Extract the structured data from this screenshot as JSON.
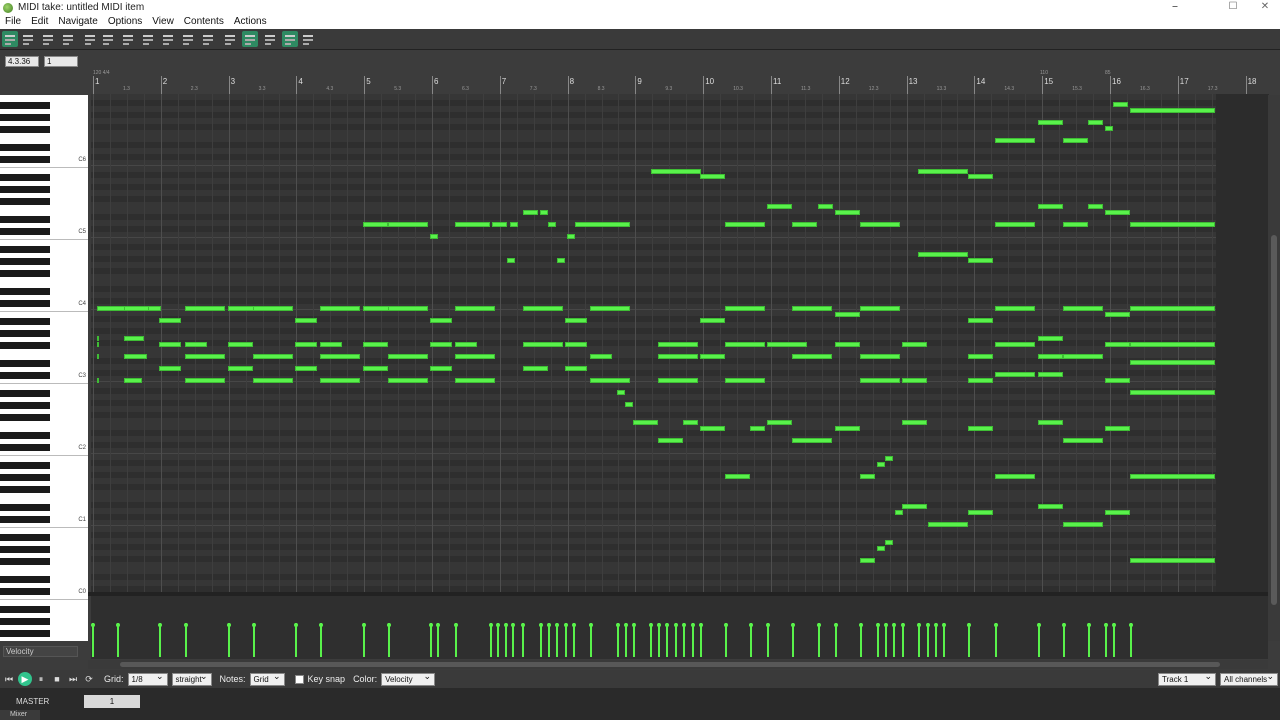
{
  "window": {
    "title": "MIDI take: untitled MIDI item",
    "min": "⎯",
    "max": "☐",
    "close": "✕"
  },
  "menu": [
    "File",
    "Edit",
    "Navigate",
    "Options",
    "View",
    "Contents",
    "Actions"
  ],
  "toolbar": {
    "icons": [
      "piano-roll-icon",
      "named-notes-icon",
      "drum-grid-icon",
      "event-list-icon",
      "snap-to-key-icon",
      "quantize-icon",
      "humanize-icon",
      "velocity-icon",
      "filter-icon",
      "window-icon",
      "loop-icon",
      "grid-icon",
      "snap-icon",
      "dots-grid-icon",
      "lasso-icon",
      "metronome-icon",
      "step-input-icon"
    ]
  },
  "position": {
    "time": "4.3.36",
    "value": "1"
  },
  "ruler": {
    "bars": [
      "1",
      "2",
      "3",
      "4",
      "5",
      "6",
      "7",
      "8",
      "9",
      "10",
      "11",
      "12",
      "13",
      "14",
      "15",
      "16",
      "17",
      "18"
    ],
    "subs": [
      "1.3",
      "2.3",
      "3.3",
      "4.3",
      "5.3",
      "6.3",
      "7.3",
      "8.3",
      "9.3",
      "10.3",
      "11.3",
      "12.3",
      "13.3",
      "14.3",
      "15.3",
      "16.3",
      "17.3"
    ],
    "markers": [
      "120 4/4",
      "110",
      "85"
    ]
  },
  "keyboard": {
    "labels": [
      "C6",
      "C5",
      "C4",
      "C3",
      "C2",
      "C1",
      "C0"
    ]
  },
  "notes": [
    [
      97,
      306,
      64
    ],
    [
      97,
      336,
      1
    ],
    [
      97,
      354,
      1
    ],
    [
      97,
      378,
      1
    ],
    [
      97,
      342,
      1
    ],
    [
      124,
      306,
      25
    ],
    [
      124,
      336,
      20
    ],
    [
      124,
      354,
      23
    ],
    [
      124,
      378,
      18
    ],
    [
      159,
      318,
      22
    ],
    [
      159,
      342,
      22
    ],
    [
      159,
      366,
      22
    ],
    [
      185,
      306,
      40
    ],
    [
      185,
      354,
      40
    ],
    [
      185,
      378,
      40
    ],
    [
      185,
      342,
      22
    ],
    [
      228,
      342,
      25
    ],
    [
      228,
      306,
      40
    ],
    [
      228,
      366,
      25
    ],
    [
      253,
      354,
      40
    ],
    [
      253,
      306,
      40
    ],
    [
      253,
      378,
      40
    ],
    [
      295,
      318,
      22
    ],
    [
      295,
      342,
      22
    ],
    [
      295,
      366,
      22
    ],
    [
      320,
      306,
      40
    ],
    [
      320,
      354,
      40
    ],
    [
      320,
      378,
      40
    ],
    [
      320,
      342,
      22
    ],
    [
      363,
      222,
      25
    ],
    [
      363,
      342,
      25
    ],
    [
      363,
      306,
      40
    ],
    [
      363,
      366,
      25
    ],
    [
      388,
      222,
      40
    ],
    [
      388,
      354,
      40
    ],
    [
      388,
      306,
      40
    ],
    [
      388,
      378,
      40
    ],
    [
      430,
      318,
      22
    ],
    [
      430,
      342,
      22
    ],
    [
      430,
      366,
      22
    ],
    [
      430,
      234,
      8
    ],
    [
      455,
      222,
      35
    ],
    [
      455,
      306,
      40
    ],
    [
      455,
      354,
      40
    ],
    [
      455,
      378,
      40
    ],
    [
      455,
      342,
      22
    ],
    [
      492,
      222,
      15
    ],
    [
      510,
      222,
      8
    ],
    [
      507,
      258,
      8
    ],
    [
      523,
      210,
      15
    ],
    [
      523,
      306,
      40
    ],
    [
      523,
      342,
      40
    ],
    [
      523,
      366,
      25
    ],
    [
      540,
      210,
      8
    ],
    [
      548,
      222,
      8
    ],
    [
      557,
      258,
      8
    ],
    [
      565,
      318,
      22
    ],
    [
      565,
      342,
      22
    ],
    [
      565,
      366,
      22
    ],
    [
      567,
      234,
      8
    ],
    [
      575,
      222,
      55
    ],
    [
      590,
      306,
      40
    ],
    [
      590,
      378,
      40
    ],
    [
      590,
      354,
      22
    ],
    [
      617,
      390,
      8
    ],
    [
      625,
      402,
      8
    ],
    [
      633,
      420,
      25
    ],
    [
      651,
      169,
      50
    ],
    [
      658,
      342,
      40
    ],
    [
      658,
      354,
      40
    ],
    [
      658,
      378,
      40
    ],
    [
      658,
      438,
      25
    ],
    [
      683,
      420,
      15
    ],
    [
      700,
      174,
      25
    ],
    [
      700,
      318,
      25
    ],
    [
      700,
      354,
      25
    ],
    [
      700,
      426,
      25
    ],
    [
      725,
      222,
      40
    ],
    [
      725,
      306,
      40
    ],
    [
      725,
      342,
      40
    ],
    [
      725,
      378,
      40
    ],
    [
      725,
      474,
      25
    ],
    [
      750,
      426,
      15
    ],
    [
      767,
      204,
      25
    ],
    [
      767,
      342,
      40
    ],
    [
      767,
      420,
      25
    ],
    [
      792,
      222,
      25
    ],
    [
      792,
      306,
      40
    ],
    [
      792,
      354,
      40
    ],
    [
      792,
      438,
      40
    ],
    [
      818,
      204,
      15
    ],
    [
      835,
      210,
      25
    ],
    [
      835,
      312,
      25
    ],
    [
      835,
      342,
      25
    ],
    [
      835,
      426,
      25
    ],
    [
      860,
      222,
      40
    ],
    [
      860,
      306,
      40
    ],
    [
      860,
      354,
      40
    ],
    [
      860,
      378,
      40
    ],
    [
      860,
      474,
      15
    ],
    [
      860,
      558,
      15
    ],
    [
      877,
      462,
      8
    ],
    [
      885,
      456,
      8
    ],
    [
      877,
      546,
      8
    ],
    [
      885,
      540,
      8
    ],
    [
      895,
      510,
      8
    ],
    [
      902,
      342,
      25
    ],
    [
      902,
      378,
      25
    ],
    [
      902,
      420,
      25
    ],
    [
      902,
      504,
      25
    ],
    [
      918,
      169,
      50
    ],
    [
      918,
      252,
      50
    ],
    [
      928,
      522,
      40
    ],
    [
      968,
      174,
      25
    ],
    [
      968,
      258,
      25
    ],
    [
      968,
      318,
      25
    ],
    [
      968,
      354,
      25
    ],
    [
      968,
      378,
      25
    ],
    [
      968,
      426,
      25
    ],
    [
      968,
      510,
      25
    ],
    [
      995,
      138,
      40
    ],
    [
      995,
      222,
      40
    ],
    [
      995,
      306,
      40
    ],
    [
      995,
      342,
      40
    ],
    [
      995,
      372,
      40
    ],
    [
      995,
      474,
      40
    ],
    [
      1038,
      120,
      25
    ],
    [
      1038,
      204,
      25
    ],
    [
      1038,
      336,
      25
    ],
    [
      1038,
      354,
      25
    ],
    [
      1038,
      372,
      25
    ],
    [
      1038,
      420,
      25
    ],
    [
      1038,
      504,
      25
    ],
    [
      1063,
      138,
      25
    ],
    [
      1063,
      222,
      25
    ],
    [
      1063,
      306,
      40
    ],
    [
      1063,
      354,
      40
    ],
    [
      1063,
      438,
      40
    ],
    [
      1063,
      522,
      40
    ],
    [
      1088,
      120,
      15
    ],
    [
      1088,
      204,
      15
    ],
    [
      1105,
      126,
      8
    ],
    [
      1105,
      210,
      25
    ],
    [
      1105,
      312,
      25
    ],
    [
      1105,
      342,
      25
    ],
    [
      1105,
      378,
      25
    ],
    [
      1105,
      426,
      25
    ],
    [
      1105,
      510,
      25
    ],
    [
      1113,
      102,
      15
    ],
    [
      1130,
      108,
      85
    ],
    [
      1130,
      222,
      85
    ],
    [
      1130,
      306,
      85
    ],
    [
      1130,
      342,
      85
    ],
    [
      1130,
      360,
      85
    ],
    [
      1130,
      390,
      85
    ],
    [
      1130,
      474,
      85
    ],
    [
      1130,
      558,
      85
    ]
  ],
  "velocity_positions": [
    92,
    117,
    159,
    185,
    228,
    253,
    295,
    320,
    363,
    388,
    430,
    437,
    455,
    490,
    497,
    505,
    512,
    522,
    540,
    548,
    556,
    565,
    573,
    590,
    617,
    625,
    633,
    650,
    658,
    666,
    675,
    683,
    692,
    700,
    725,
    750,
    767,
    792,
    818,
    835,
    860,
    877,
    885,
    893,
    902,
    918,
    927,
    935,
    943,
    968,
    995,
    1038,
    1063,
    1088,
    1105,
    1113,
    1130
  ],
  "lane": {
    "label": "Velocity"
  },
  "bottom": {
    "grid_label": "Grid:",
    "grid_value": "1/8",
    "swing": "straight",
    "notes_label": "Notes:",
    "notes_value": "Grid",
    "keysnap_label": "Key snap",
    "color_label": "Color:",
    "color_value": "Velocity",
    "track": "Track 1",
    "channels": "All channels"
  },
  "mixer": {
    "master": "MASTER",
    "volume": "1",
    "tab": "Mixer"
  }
}
